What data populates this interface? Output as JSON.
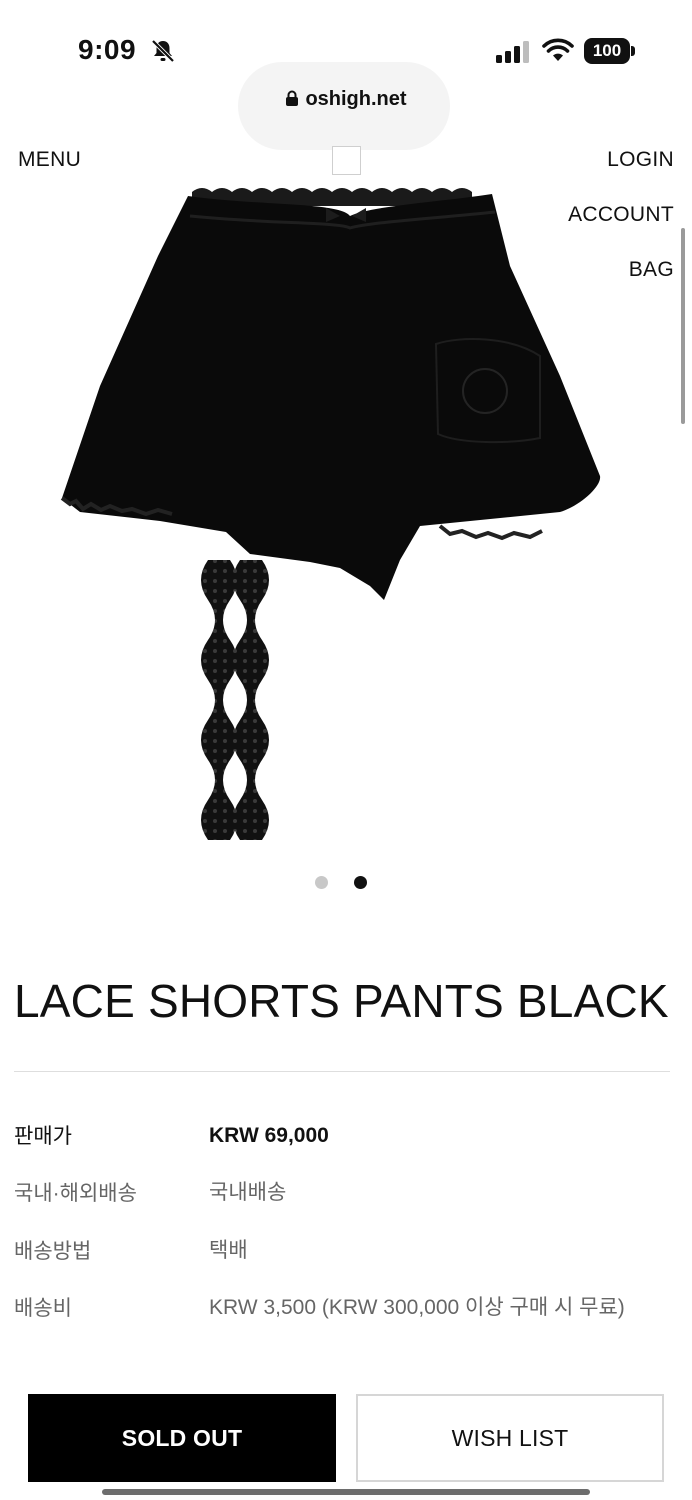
{
  "status_bar": {
    "time": "9:09",
    "battery": "100"
  },
  "browser": {
    "url": "oshigh.net"
  },
  "nav": {
    "menu": "MENU",
    "login": "LOGIN",
    "account": "ACCOUNT",
    "bag": "BAG"
  },
  "carousel": {
    "count": 2,
    "active_index": 2
  },
  "product": {
    "title": "LACE SHORTS PANTS BLACK",
    "details": [
      {
        "label": "판매가",
        "value": "KRW 69,000"
      },
      {
        "label": "국내·해외배송",
        "value": "국내배송"
      },
      {
        "label": "배송방법",
        "value": "택배"
      },
      {
        "label": "배송비",
        "value": "KRW 3,500 (KRW 300,000 이상 구매 시 무료)"
      }
    ]
  },
  "actions": {
    "sold_out": "SOLD OUT",
    "wish_list": "WISH LIST"
  },
  "colors": {
    "primary_button": "#000000",
    "text": "#111111",
    "muted": "#666666"
  }
}
